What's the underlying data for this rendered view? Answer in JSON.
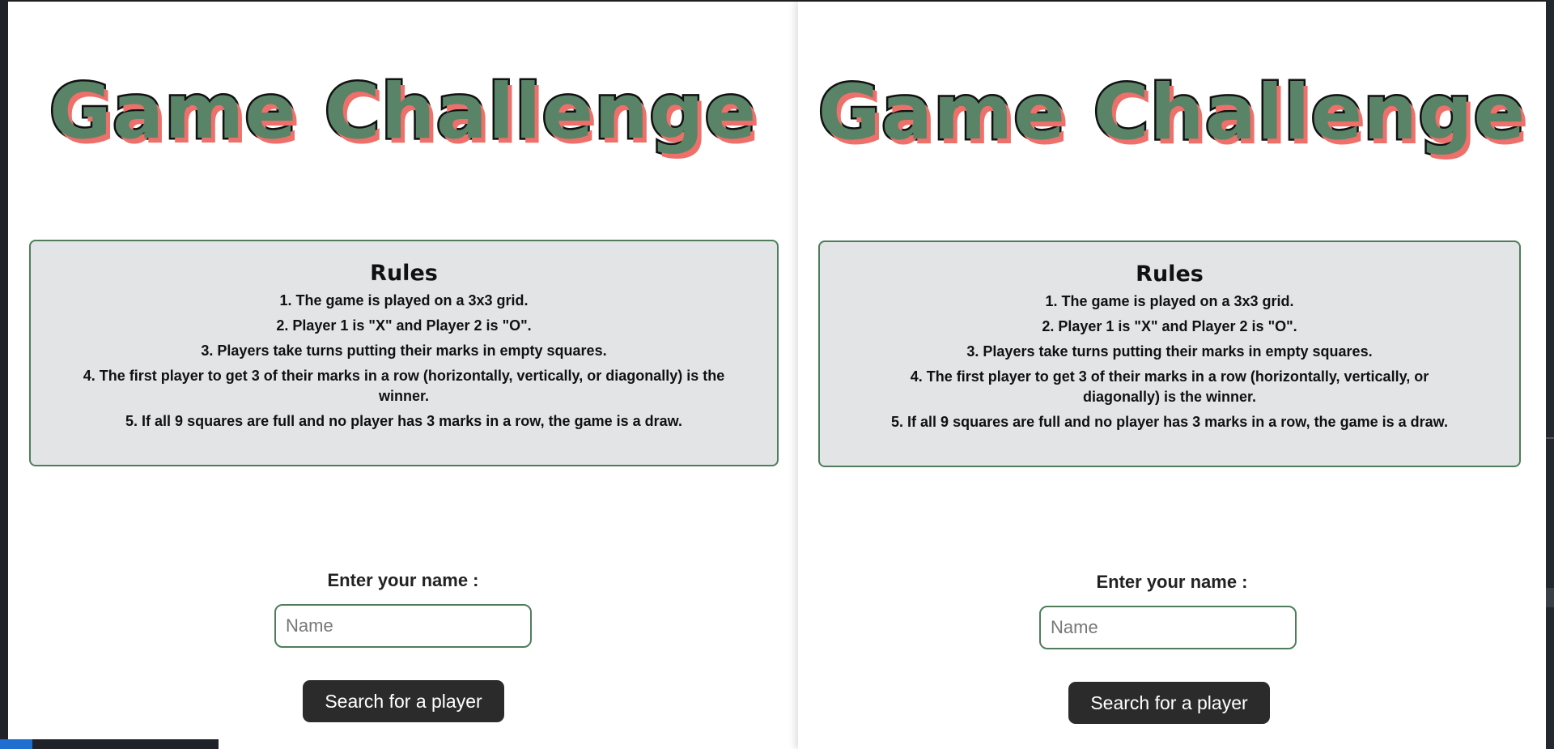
{
  "windows": [
    {
      "title": "Game Challenge",
      "rules": {
        "heading": "Rules",
        "items": [
          "1. The game is played on a 3x3 grid.",
          "2. Player 1 is \"X\" and Player 2 is \"O\".",
          "3. Players take turns putting their marks in empty squares.",
          "4. The first player to get 3 of their marks in a row (horizontally, vertically, or diagonally) is the winner.",
          "5. If all 9 squares are full and no player has 3 marks in a row, the game is a draw."
        ]
      },
      "name_label": "Enter your name :",
      "name_placeholder": "Name",
      "name_value": "",
      "button_label": "Search for a player"
    },
    {
      "title": "Game Challenge",
      "rules": {
        "heading": "Rules",
        "items": [
          "1. The game is played on a 3x3 grid.",
          "2. Player 1 is \"X\" and Player 2 is \"O\".",
          "3. Players take turns putting their marks in empty squares.",
          "4. The first player to get 3 of their marks in a row (horizontally, vertically, or diagonally) is the winner.",
          "5. If all 9 squares are full and no player has 3 marks in a row, the game is a draw."
        ]
      },
      "name_label": "Enter your name :",
      "name_placeholder": "Name",
      "name_value": "",
      "button_label": "Search for a player"
    }
  ],
  "colors": {
    "title_fill": "#5a8468",
    "title_stroke": "#111111",
    "title_shadow": "#ef6f6a",
    "rules_bg": "#e2e4e6",
    "accent_border": "#4f7d5c",
    "button_bg": "#2b2b2b",
    "button_text": "#ffffff"
  }
}
